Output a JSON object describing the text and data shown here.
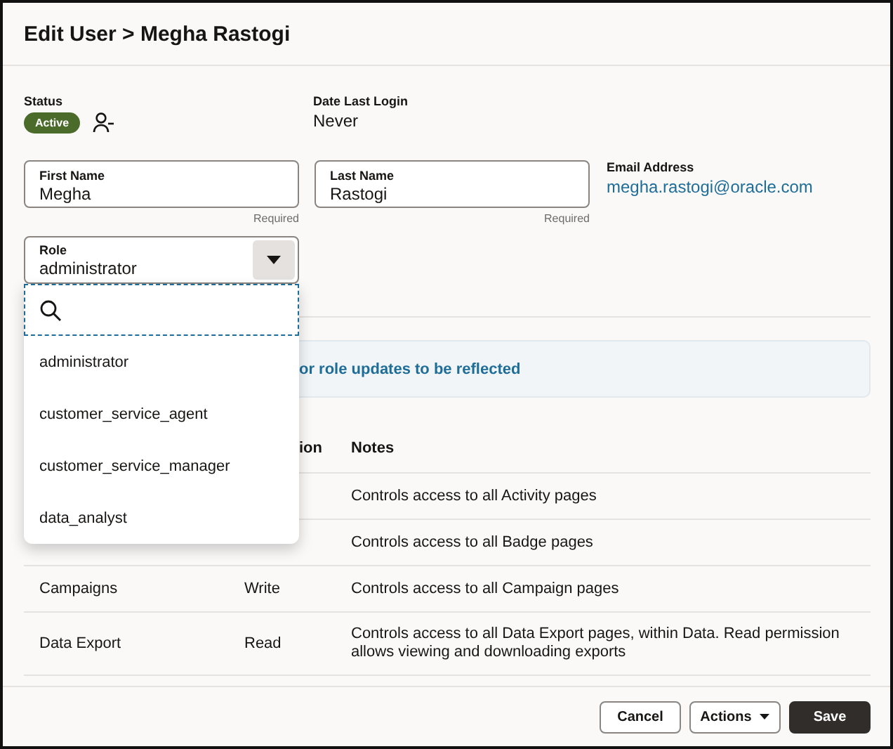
{
  "dialog": {
    "title": "Edit User > Megha Rastogi"
  },
  "status": {
    "label": "Status",
    "badge": "Active"
  },
  "last_login": {
    "label": "Date Last Login",
    "value": "Never"
  },
  "fields": [
    {
      "label": "First Name",
      "value": "Megha",
      "hint": "Required"
    },
    {
      "label": "Last Name",
      "value": "Rastogi",
      "hint": "Required"
    }
  ],
  "email": {
    "label": "Email Address",
    "value": "megha.rastogi@oracle.com"
  },
  "role": {
    "label": "Role",
    "value": "administrator",
    "expanded": true,
    "options": [
      {
        "label": "administrator"
      },
      {
        "label": "customer_service_agent"
      },
      {
        "label": "customer_service_manager"
      },
      {
        "label": "data_analyst"
      }
    ]
  },
  "banner": {
    "text": "or role updates to be reflected"
  },
  "table": {
    "columns": [
      {
        "label": "ion"
      },
      {
        "label": "Notes"
      }
    ],
    "rows": [
      {
        "notes": "Controls access to all Activity pages"
      },
      {
        "notes": "Controls access to all Badge pages"
      },
      {
        "column_1": "Campaigns",
        "column_2": "Write",
        "notes": "Controls access to all Campaign pages"
      },
      {
        "column_1": "Data Export",
        "column_2": "Read",
        "notes": "Controls access to all Data Export pages, within Data. Read permission allows viewing and downloading exports"
      }
    ]
  },
  "buttons": [
    {
      "label": "Cancel",
      "kind": "secondary"
    },
    {
      "label": "Actions",
      "kind": "menu"
    },
    {
      "label": "Save",
      "kind": "primary"
    }
  ]
}
